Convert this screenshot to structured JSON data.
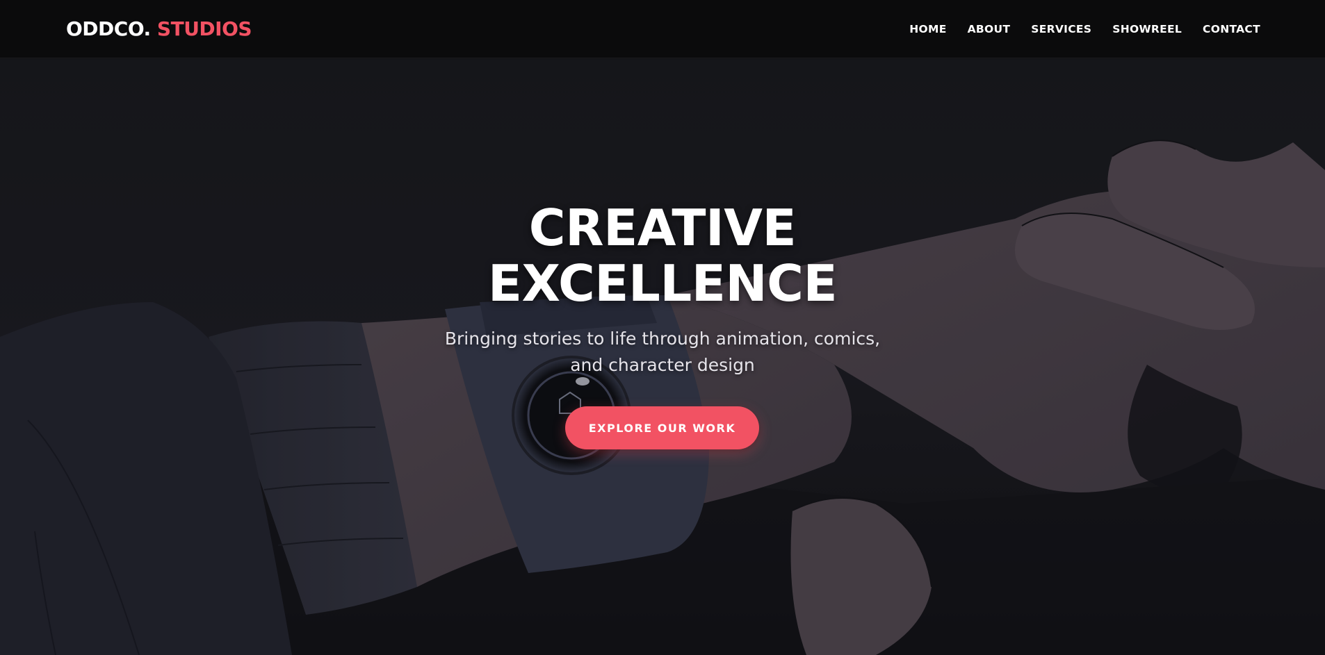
{
  "brand": {
    "name_primary": "ODDCO.",
    "name_accent": "STUDIOS",
    "accent_color": "#f25263"
  },
  "nav": {
    "items": [
      {
        "label": "HOME"
      },
      {
        "label": "ABOUT"
      },
      {
        "label": "SERVICES"
      },
      {
        "label": "SHOWREEL"
      },
      {
        "label": "CONTACT"
      }
    ]
  },
  "hero": {
    "title_line1": "CREATIVE",
    "title_line2": "EXCELLENCE",
    "subtitle": "Bringing stories to life through animation, comics, and character design",
    "cta_label": "EXPLORE OUR WORK",
    "background_art": "animated-hand-with-smartwatch-illustration"
  }
}
